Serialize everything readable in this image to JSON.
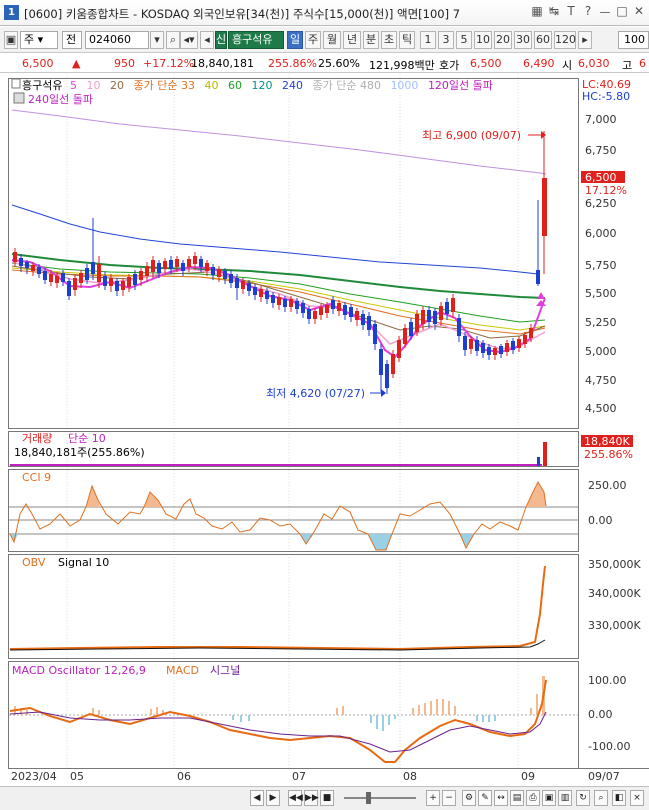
{
  "window": {
    "number_badge": "1",
    "title": "[0600] 키움종합차트 - KOSDAQ 외국인보유[34(천)] 주식수[15,000(천)] 액면[100] 7",
    "controls": [
      "▦",
      "↹",
      "T",
      "?",
      "ㅡ",
      "□",
      "✕"
    ]
  },
  "toolbar": {
    "market": "주",
    "period_type": "전",
    "code": "024060",
    "badge_new": "신",
    "stock_name": "흥구석유",
    "periods": [
      "일",
      "주",
      "월",
      "년",
      "분",
      "초",
      "틱"
    ],
    "active_period": "일",
    "intervals": [
      "1",
      "3",
      "5",
      "10",
      "20",
      "30",
      "60",
      "120"
    ],
    "count": "100"
  },
  "price_info": {
    "price": "6,500",
    "change": "950",
    "change_pct": "+17.12%",
    "volume": "18,840,181",
    "volume_ratio": "255.86%",
    "turnover": "25.60%",
    "amount": "121,998백만",
    "ask_label": "호가",
    "ask": "6,500",
    "bid": "6,490",
    "open_label": "시",
    "open": "6,030",
    "high_label": "고",
    "high": "6"
  },
  "price_panel": {
    "legend": [
      {
        "text": "흥구석유",
        "color": "#000000"
      },
      {
        "text": "5",
        "color": "#e040e0"
      },
      {
        "text": "10",
        "color": "#f0a0d0"
      },
      {
        "text": "20",
        "color": "#8a6a40"
      },
      {
        "text": "종가 단순 33",
        "color": "#e07020"
      },
      {
        "text": "40",
        "color": "#c8c800"
      },
      {
        "text": "60",
        "color": "#20a020"
      },
      {
        "text": "120",
        "color": "#009090"
      },
      {
        "text": "240",
        "color": "#1f45d6"
      },
      {
        "text": "종가 단순 480",
        "color": "#b0b0b0"
      },
      {
        "text": "1000",
        "color": "#a0c0ff"
      },
      {
        "text": "120일선 돌파",
        "color": "#c020c0"
      }
    ],
    "legend_line2": "240일선 돌파",
    "lc": "LC:40.69",
    "hc": "HC:-5.80",
    "y_ticks": [
      "7,000",
      "6,750",
      "6,500",
      "6,250",
      "6,000",
      "5,750",
      "5,500",
      "5,250",
      "5,000",
      "4,750",
      "4,500"
    ],
    "current_price_tag": "6,500",
    "current_pct_tag": "17.12%",
    "high_annotation": "최고 6,900 (09/07)",
    "low_annotation": "최저 4,620 (07/27)"
  },
  "volume_panel": {
    "legend_title": "거래량",
    "legend_ma": "단순 10",
    "value_text": "18,840,181주(255.86%)",
    "tag_value": "18,840K",
    "tag_pct": "255.86%"
  },
  "cci_panel": {
    "legend": "CCI 9",
    "y_ticks": [
      "250.00",
      "0.00"
    ]
  },
  "obv_panel": {
    "legend": "OBV",
    "legend_signal": "Signal 10",
    "y_ticks": [
      "350,000K",
      "340,000K",
      "330,000K"
    ]
  },
  "macd_panel": {
    "legend_osc": "MACD Oscillator 12,26,9",
    "legend_macd": "MACD",
    "legend_signal": "시그널",
    "y_ticks": [
      "100.00",
      "0.00",
      "-100.00"
    ]
  },
  "x_axis": {
    "labels": [
      "2023/04",
      "05",
      "06",
      "07",
      "08",
      "09",
      "09/07"
    ]
  },
  "colors": {
    "up": "#e0201c",
    "down": "#1b3fd1",
    "ma5": "#e040e0",
    "ma60": "#20a020",
    "ma240": "#1f45d6",
    "ma480": "#c090e0",
    "cci_fill_up": "#f4b98e",
    "cci_fill_down": "#9ad0e4",
    "obv_line": "#e86a10",
    "macd_line": "#e86a10",
    "signal_line": "#6a2090"
  },
  "bottom": {
    "nav_buttons": [
      "◀",
      "▶",
      "◀◀",
      "▶▶",
      "■"
    ],
    "zoom_buttons": [
      "+",
      "−"
    ]
  }
}
